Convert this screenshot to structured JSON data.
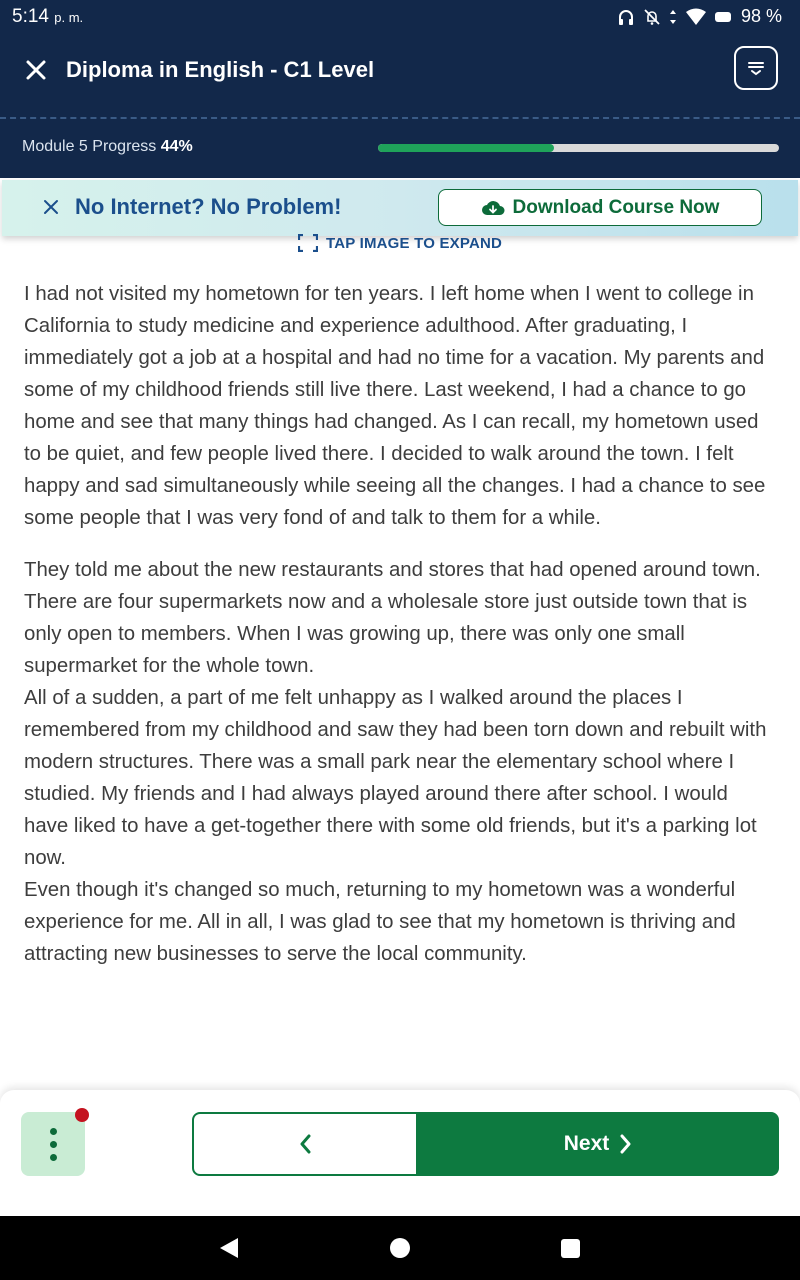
{
  "status_bar": {
    "time": "5:14",
    "ampm": "p. m.",
    "battery": "98 %"
  },
  "header": {
    "title": "Diploma in English - C1 Level",
    "progress_label": "Module 5 Progress",
    "progress_value": "44%",
    "progress_fraction": 0.44
  },
  "banner": {
    "message": "No Internet? No Problem!",
    "download_label": "Download Course Now"
  },
  "expand_hint": "TAP IMAGE TO EXPAND",
  "content": {
    "paragraphs": [
      "I had not visited my hometown for ten years. I left home when I went to college in California to study medicine and experience adulthood. After graduating, I immediately got a job at a hospital and had no time for a vacation. My parents and some of my childhood friends still live there. Last weekend, I had a chance to go home and see that many things had changed. As I can recall, my hometown used to be quiet, and few people lived there. I decided to walk around the town. I felt happy and sad simultaneously while seeing all the changes. I had a chance to see some people that I was very fond of and talk to them for a while.",
      "They told me about the new restaurants and stores that had opened around town. There are four supermarkets now and a wholesale store just outside town that is only open to members. When I was growing up, there was only one small supermarket for the whole town.",
      "All of a sudden, a part of me felt unhappy as I walked around the places I remembered from my childhood and saw they had been torn down and rebuilt with modern structures. There was a small park near the elementary school where I studied. My friends and I had always played around there after school. I would have liked to have a get-together there with some old friends, but it's a parking lot now.",
      "Even though it's changed so much, returning to my hometown was a wonderful experience for me. All in all, I was glad to see that my hometown is thriving and attracting new businesses to serve the local community."
    ]
  },
  "footer": {
    "next_label": "Next"
  },
  "colors": {
    "header_bg": "#12284a",
    "accent_green": "#0d7a40",
    "progress_fill": "#1fa35a",
    "banner_text": "#1b4f8c",
    "notification": "#c4121f"
  }
}
